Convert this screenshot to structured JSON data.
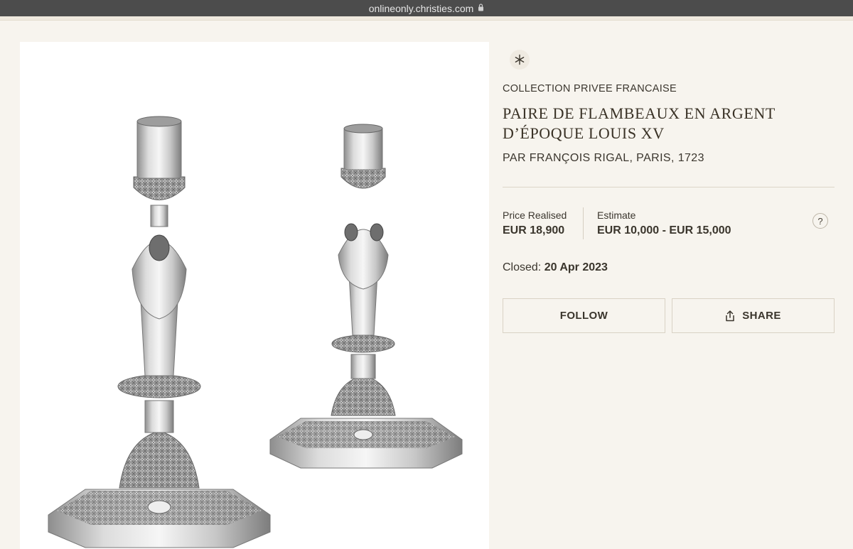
{
  "browser": {
    "url": "onlineonly.christies.com"
  },
  "lot": {
    "badge_icon": "asterisk-icon",
    "collection": "COLLECTION PRIVEE FRANCAISE",
    "title_line1": "PAIRE DE FLAMBEAUX EN ARGENT",
    "title_line2": "D’ÉPOQUE LOUIS XV",
    "subtitle": "PAR FRANÇOIS RIGAL, PARIS, 1723"
  },
  "pricing": {
    "price_label": "Price Realised",
    "price_value": "EUR 18,900",
    "estimate_label": "Estimate",
    "estimate_value": "EUR 10,000 - EUR 15,000",
    "help_symbol": "?"
  },
  "status": {
    "closed_label": "Closed:",
    "closed_date": "20 Apr 2023"
  },
  "actions": {
    "follow_label": "FOLLOW",
    "share_label": "SHARE"
  },
  "colors": {
    "page_bg": "#f7f4ee",
    "title_text": "#3a3226",
    "border": "#d9d2c5"
  }
}
